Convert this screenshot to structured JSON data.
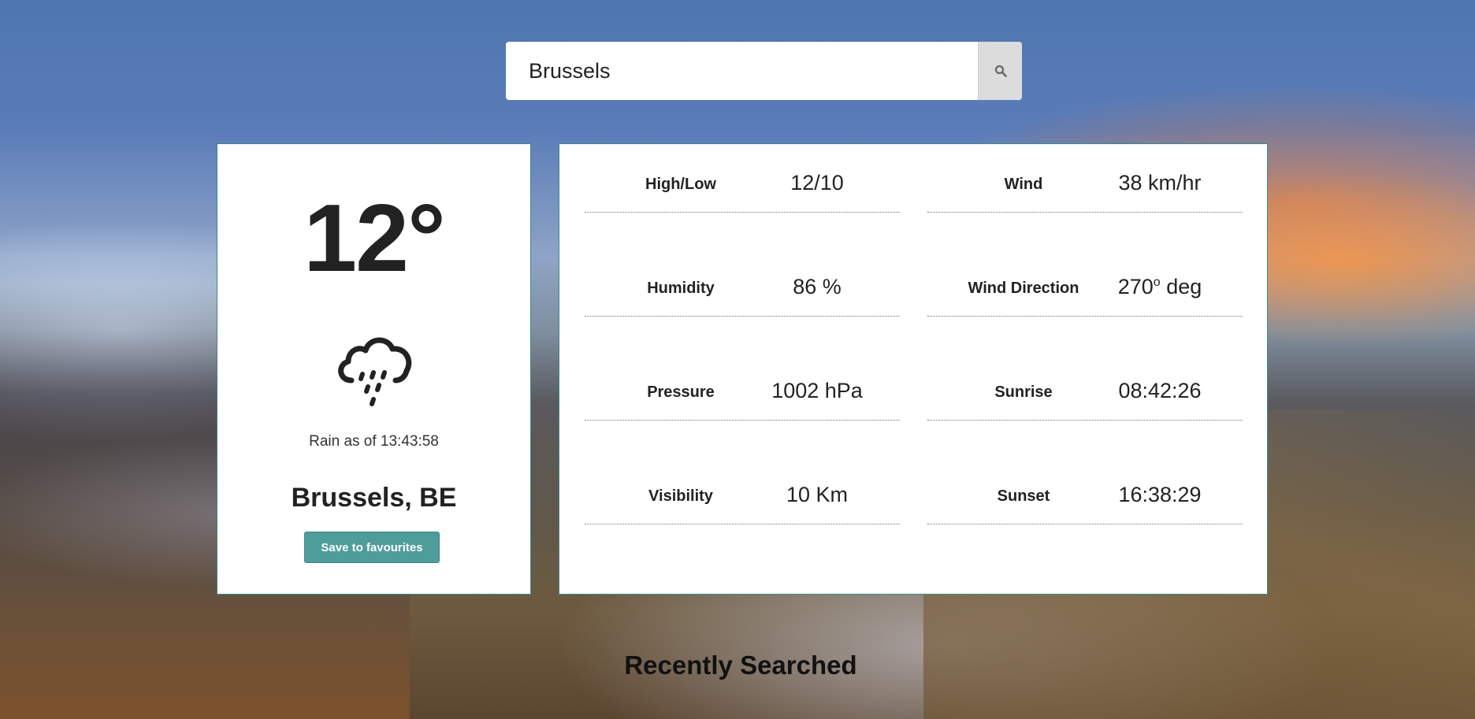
{
  "search": {
    "value": "Brussels",
    "placeholder": ""
  },
  "current": {
    "temperature": "12°",
    "condition_text": "Rain as of 13:43:58",
    "condition_icon": "rain-cloud-icon",
    "city": "Brussels, BE",
    "favourite_label": "Save to favourites"
  },
  "stats": [
    {
      "label": "High/Low",
      "value": "12/10"
    },
    {
      "label": "Wind",
      "value": "38 km/hr"
    },
    {
      "label": "Humidity",
      "value": "86 %"
    },
    {
      "label": "Wind Direction",
      "value": "270",
      "unit": "deg",
      "sup": "o"
    },
    {
      "label": "Pressure",
      "value": "1002 hPa"
    },
    {
      "label": "Sunrise",
      "value": "08:42:26"
    },
    {
      "label": "Visibility",
      "value": "10 Km"
    },
    {
      "label": "Sunset",
      "value": "16:38:29"
    }
  ],
  "recent": {
    "heading": "Recently Searched"
  },
  "colors": {
    "accent": "#4e9d9a",
    "card_border": "#3a8a8a"
  }
}
